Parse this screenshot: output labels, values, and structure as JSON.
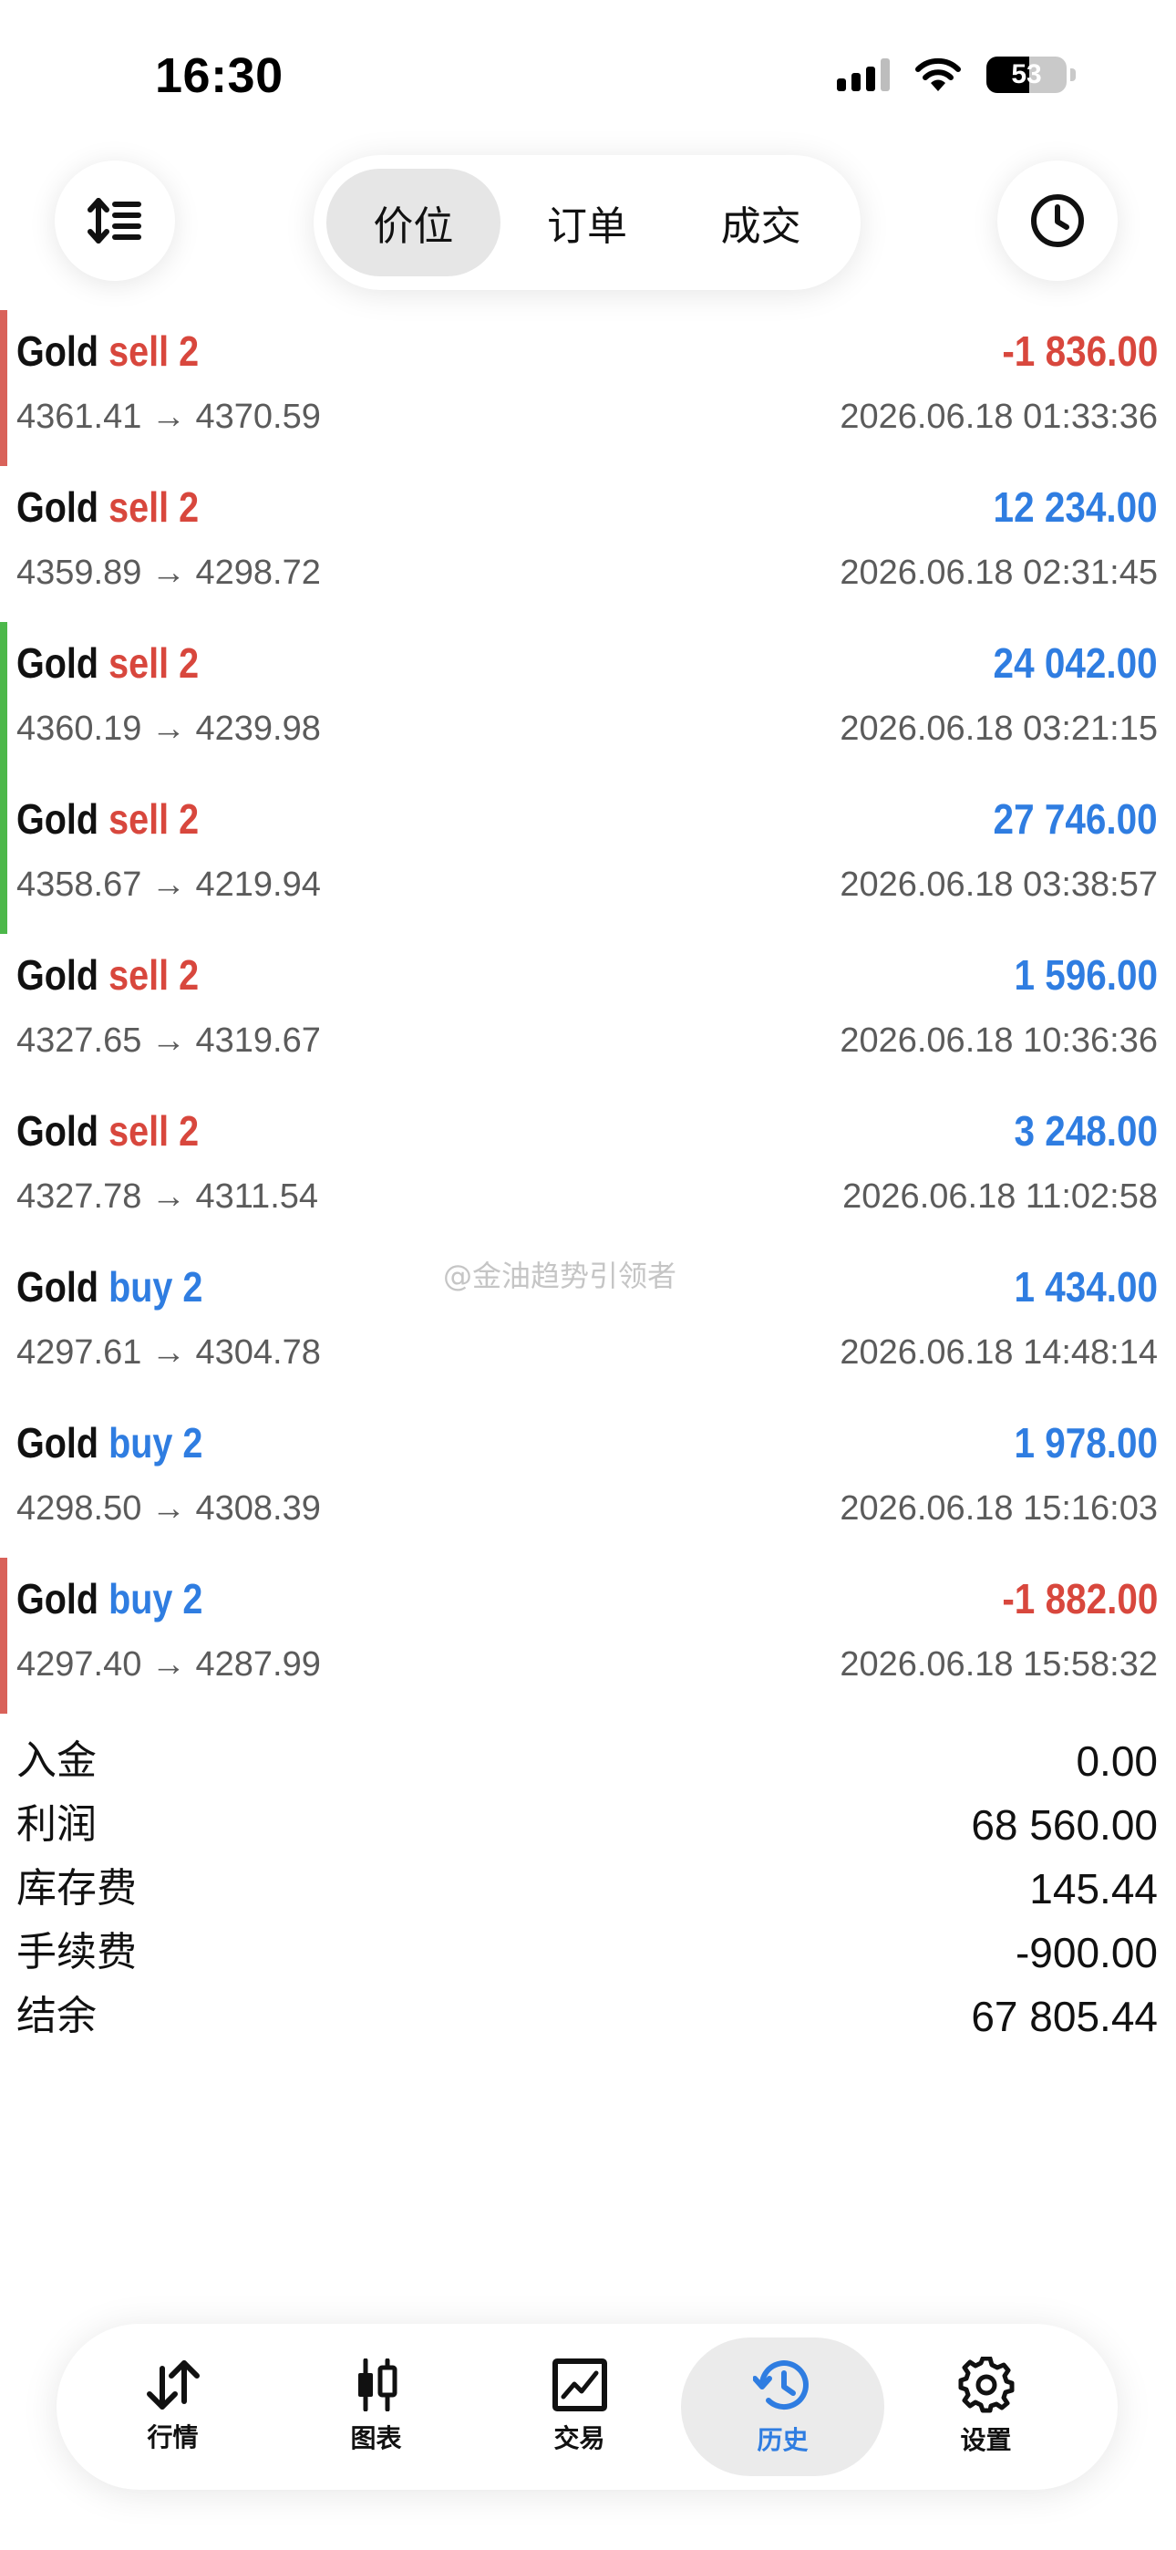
{
  "status_bar": {
    "time": "16:30",
    "battery": "53"
  },
  "toolbar": {
    "tabs": [
      {
        "label": "价位",
        "active": true
      },
      {
        "label": "订单",
        "active": false
      },
      {
        "label": "成交",
        "active": false
      }
    ]
  },
  "colors": {
    "loss": "#d8473d",
    "profit": "#2f7de1",
    "buy": "#2f7de1",
    "sell": "#d8473d",
    "marker_red": "#d9625a",
    "marker_green": "#4cb84a"
  },
  "trades": [
    {
      "symbol": "Gold",
      "side": "sell 2",
      "side_type": "sell",
      "prices": "4361.41 → 4370.59",
      "profit": "-1 836.00",
      "profit_type": "loss",
      "time": "2026.06.18 01:33:36",
      "marker": "red"
    },
    {
      "symbol": "Gold",
      "side": "sell 2",
      "side_type": "sell",
      "prices": "4359.89 → 4298.72",
      "profit": "12 234.00",
      "profit_type": "profit",
      "time": "2026.06.18 02:31:45",
      "marker": "none"
    },
    {
      "symbol": "Gold",
      "side": "sell 2",
      "side_type": "sell",
      "prices": "4360.19 → 4239.98",
      "profit": "24 042.00",
      "profit_type": "profit",
      "time": "2026.06.18 03:21:15",
      "marker": "green"
    },
    {
      "symbol": "Gold",
      "side": "sell 2",
      "side_type": "sell",
      "prices": "4358.67 → 4219.94",
      "profit": "27 746.00",
      "profit_type": "profit",
      "time": "2026.06.18 03:38:57",
      "marker": "green"
    },
    {
      "symbol": "Gold",
      "side": "sell 2",
      "side_type": "sell",
      "prices": "4327.65 → 4319.67",
      "profit": "1 596.00",
      "profit_type": "profit",
      "time": "2026.06.18 10:36:36",
      "marker": "none"
    },
    {
      "symbol": "Gold",
      "side": "sell 2",
      "side_type": "sell",
      "prices": "4327.78 → 4311.54",
      "profit": "3 248.00",
      "profit_type": "profit",
      "time": "2026.06.18 11:02:58",
      "marker": "none"
    },
    {
      "symbol": "Gold",
      "side": "buy 2",
      "side_type": "buy",
      "prices": "4297.61 → 4304.78",
      "profit": "1 434.00",
      "profit_type": "profit",
      "time": "2026.06.18 14:48:14",
      "marker": "none"
    },
    {
      "symbol": "Gold",
      "side": "buy 2",
      "side_type": "buy",
      "prices": "4298.50 → 4308.39",
      "profit": "1 978.00",
      "profit_type": "profit",
      "time": "2026.06.18 15:16:03",
      "marker": "none"
    },
    {
      "symbol": "Gold",
      "side": "buy 2",
      "side_type": "buy",
      "prices": "4297.40 → 4287.99",
      "profit": "-1 882.00",
      "profit_type": "loss",
      "time": "2026.06.18 15:58:32",
      "marker": "red"
    }
  ],
  "watermark": "@金油趋势引领者",
  "summary": [
    {
      "label": "入金",
      "value": "0.00"
    },
    {
      "label": "利润",
      "value": "68 560.00"
    },
    {
      "label": "库存费",
      "value": "145.44"
    },
    {
      "label": "手续费",
      "value": "-900.00"
    },
    {
      "label": "结余",
      "value": "67 805.44"
    }
  ],
  "bottom_nav": [
    {
      "label": "行情",
      "icon": "quotes-arrows-icon",
      "active": false
    },
    {
      "label": "图表",
      "icon": "candlestick-chart-icon",
      "active": false
    },
    {
      "label": "交易",
      "icon": "trade-chart-icon",
      "active": false
    },
    {
      "label": "历史",
      "icon": "history-clock-icon",
      "active": true
    },
    {
      "label": "设置",
      "icon": "gear-icon",
      "active": false
    }
  ]
}
